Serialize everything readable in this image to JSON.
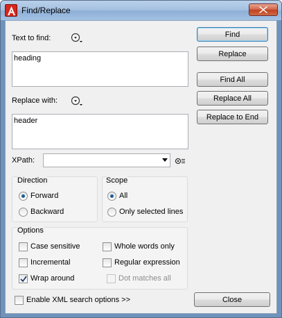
{
  "window": {
    "title": "Find/Replace"
  },
  "find": {
    "label": "Text to find:",
    "value": "heading",
    "pattern_icon": "regex-helper-icon"
  },
  "replace": {
    "label": "Replace with:",
    "value": "header",
    "pattern_icon": "regex-helper-icon"
  },
  "xpath": {
    "label": "XPath:",
    "value": "",
    "settings_icon": "xpath-settings-icon"
  },
  "buttons": {
    "find": "Find",
    "replace": "Replace",
    "find_all": "Find All",
    "replace_all": "Replace All",
    "replace_to_end": "Replace to End",
    "close": "Close"
  },
  "direction": {
    "title": "Direction",
    "forward": "Forward",
    "backward": "Backward",
    "selected": "forward"
  },
  "scope": {
    "title": "Scope",
    "all": "All",
    "only_selected": "Only selected lines",
    "selected": "all"
  },
  "options": {
    "title": "Options",
    "case_sensitive": "Case sensitive",
    "whole_words": "Whole words only",
    "incremental": "Incremental",
    "regex": "Regular expression",
    "wrap_around": "Wrap around",
    "dot_matches_all": "Dot matches all",
    "checked": {
      "case_sensitive": false,
      "whole_words": false,
      "incremental": false,
      "regex": false,
      "wrap_around": true,
      "dot_matches_all": false
    }
  },
  "xml_search": {
    "label": "Enable XML search options >>",
    "checked": false
  }
}
